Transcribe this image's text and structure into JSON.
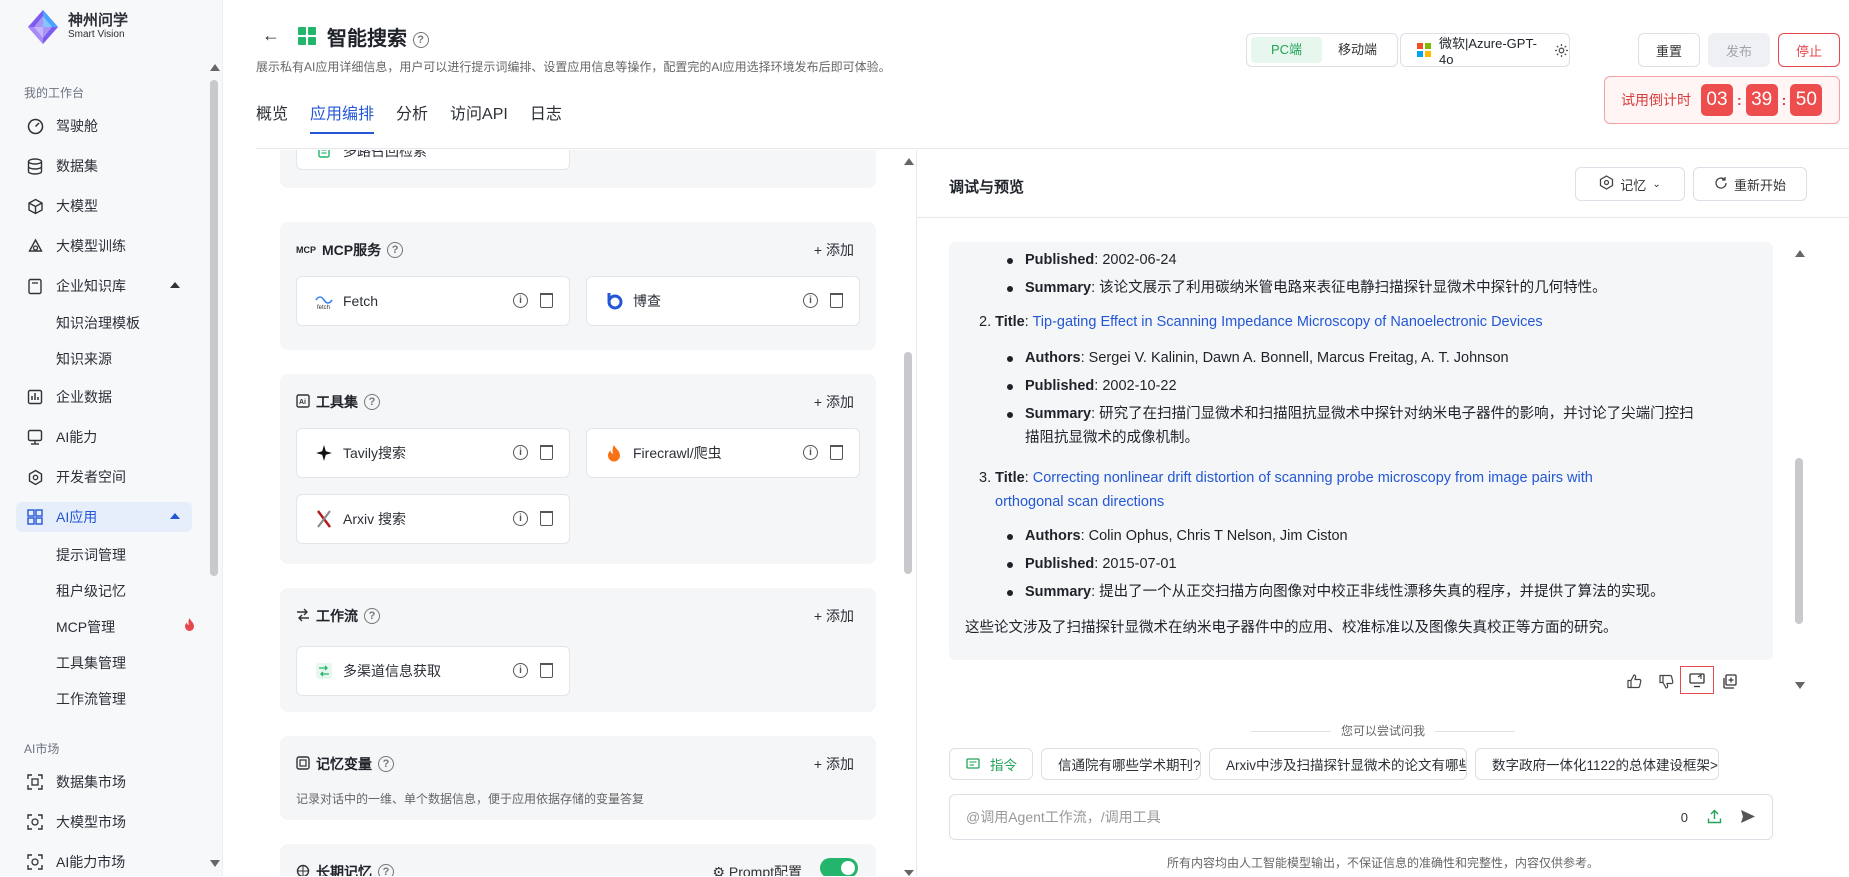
{
  "brand": {
    "name_cn": "神州问学",
    "name_en": "Smart Vision"
  },
  "sidebar": {
    "workspace_label": "我的工作台",
    "items": [
      {
        "label": "驾驶舱"
      },
      {
        "label": "数据集"
      },
      {
        "label": "大模型"
      },
      {
        "label": "大模型训练"
      },
      {
        "label": "企业知识库"
      },
      {
        "label": "知识治理模板"
      },
      {
        "label": "知识来源"
      },
      {
        "label": "企业数据"
      },
      {
        "label": "AI能力"
      },
      {
        "label": "开发者空间"
      },
      {
        "label": "AI应用"
      },
      {
        "label": "提示词管理"
      },
      {
        "label": "租户级记忆"
      },
      {
        "label": "MCP管理"
      },
      {
        "label": "工具集管理"
      },
      {
        "label": "工作流管理"
      }
    ],
    "market_label": "AI市场",
    "market_items": [
      {
        "label": "数据集市场"
      },
      {
        "label": "大模型市场"
      },
      {
        "label": "AI能力市场"
      }
    ]
  },
  "header": {
    "title": "智能搜索",
    "description": "展示私有AI应用详细信息，用户可以进行提示词编排、设置应用信息等操作，配置完的AI应用选择环境发布后即可体验。",
    "tabs": [
      {
        "label": "概览"
      },
      {
        "label": "应用编排"
      },
      {
        "label": "分析"
      },
      {
        "label": "访问API"
      },
      {
        "label": "日志"
      }
    ],
    "platform": {
      "pc": "PC端",
      "mobile": "移动端"
    },
    "model": "微软|Azure-GPT-4o",
    "reset": "重置",
    "publish": "发布",
    "stop": "停止",
    "timer": {
      "label": "试用倒计时",
      "h": "03",
      "m": "39",
      "s": "50"
    }
  },
  "left": {
    "multi_recall": "多路召回检索",
    "mcp": {
      "title": "MCP服务",
      "add": "添加",
      "items": [
        {
          "label": "Fetch"
        },
        {
          "label": "博查"
        }
      ]
    },
    "tools": {
      "title": "工具集",
      "add": "添加",
      "items": [
        {
          "label": "Tavily搜索"
        },
        {
          "label": "Firecrawl/爬虫"
        },
        {
          "label": "Arxiv 搜索"
        }
      ]
    },
    "workflow": {
      "title": "工作流",
      "add": "添加",
      "items": [
        {
          "label": "多渠道信息获取"
        }
      ]
    },
    "memvar": {
      "title": "记忆变量",
      "add": "添加",
      "desc": "记录对话中的一维、单个数据信息，便于应用依据存储的变量答复"
    },
    "longmem": {
      "title": "长期记忆",
      "prompt_config": "Prompt配置"
    }
  },
  "right": {
    "title": "调试与预览",
    "memory_btn": "记忆",
    "restart_btn": "重新开始",
    "message": {
      "p1_published_k": "Published",
      "p1_published_v": ": 2002-06-24",
      "p1_summary_k": "Summary",
      "p1_summary_v": ": 该论文展示了利用碳纳米管电路来表征电静扫描探针显微术中探针的几何特性。",
      "p2_num": "2.",
      "p2_title_k": "Title",
      "p2_title_v": "Tip-gating Effect in Scanning Impedance Microscopy of Nanoelectronic Devices",
      "p2_authors_k": "Authors",
      "p2_authors_v": ": Sergei V. Kalinin, Dawn A. Bonnell, Marcus Freitag, A. T. Johnson",
      "p2_published_k": "Published",
      "p2_published_v": ": 2002-10-22",
      "p2_summary_k": "Summary",
      "p2_summary_v1": ": 研究了在扫描门显微术和扫描阻抗显微术中探针对纳米电子器件的影响，并讨论了尖端门控扫",
      "p2_summary_v2": "描阻抗显微术的成像机制。",
      "p3_num": "3.",
      "p3_title_k": "Title",
      "p3_title_v1": "Correcting nonlinear drift distortion of scanning probe microscopy from image pairs with",
      "p3_title_v2": "orthogonal scan directions",
      "p3_authors_k": "Authors",
      "p3_authors_v": ": Colin Ophus, Chris T Nelson, Jim Ciston",
      "p3_published_k": "Published",
      "p3_published_v": ": 2015-07-01",
      "p3_summary_k": "Summary",
      "p3_summary_v": ": 提出了一个从正交扫描方向图像对中校正非线性漂移失真的程序，并提供了算法的实现。",
      "conclusion": "这些论文涉及了扫描探针显微术在纳米电子器件中的应用、校准标准以及图像失真校正等方面的研究。"
    },
    "suggest_label": "您可以尝试问我",
    "chips": [
      {
        "label": "指令"
      },
      {
        "label": "信通院有哪些学术期刊?"
      },
      {
        "label": "Arxiv中涉及扫描探针显微术的论文有哪些?"
      },
      {
        "label": "数字政府一体化1122的总体建设框架>"
      }
    ],
    "input_placeholder": "@调用Agent工作流，/调用工具",
    "input_count": "0",
    "footnote": "所有内容均由人工智能模型输出，不保证信息的准确性和完整性，内容仅供参考。"
  }
}
